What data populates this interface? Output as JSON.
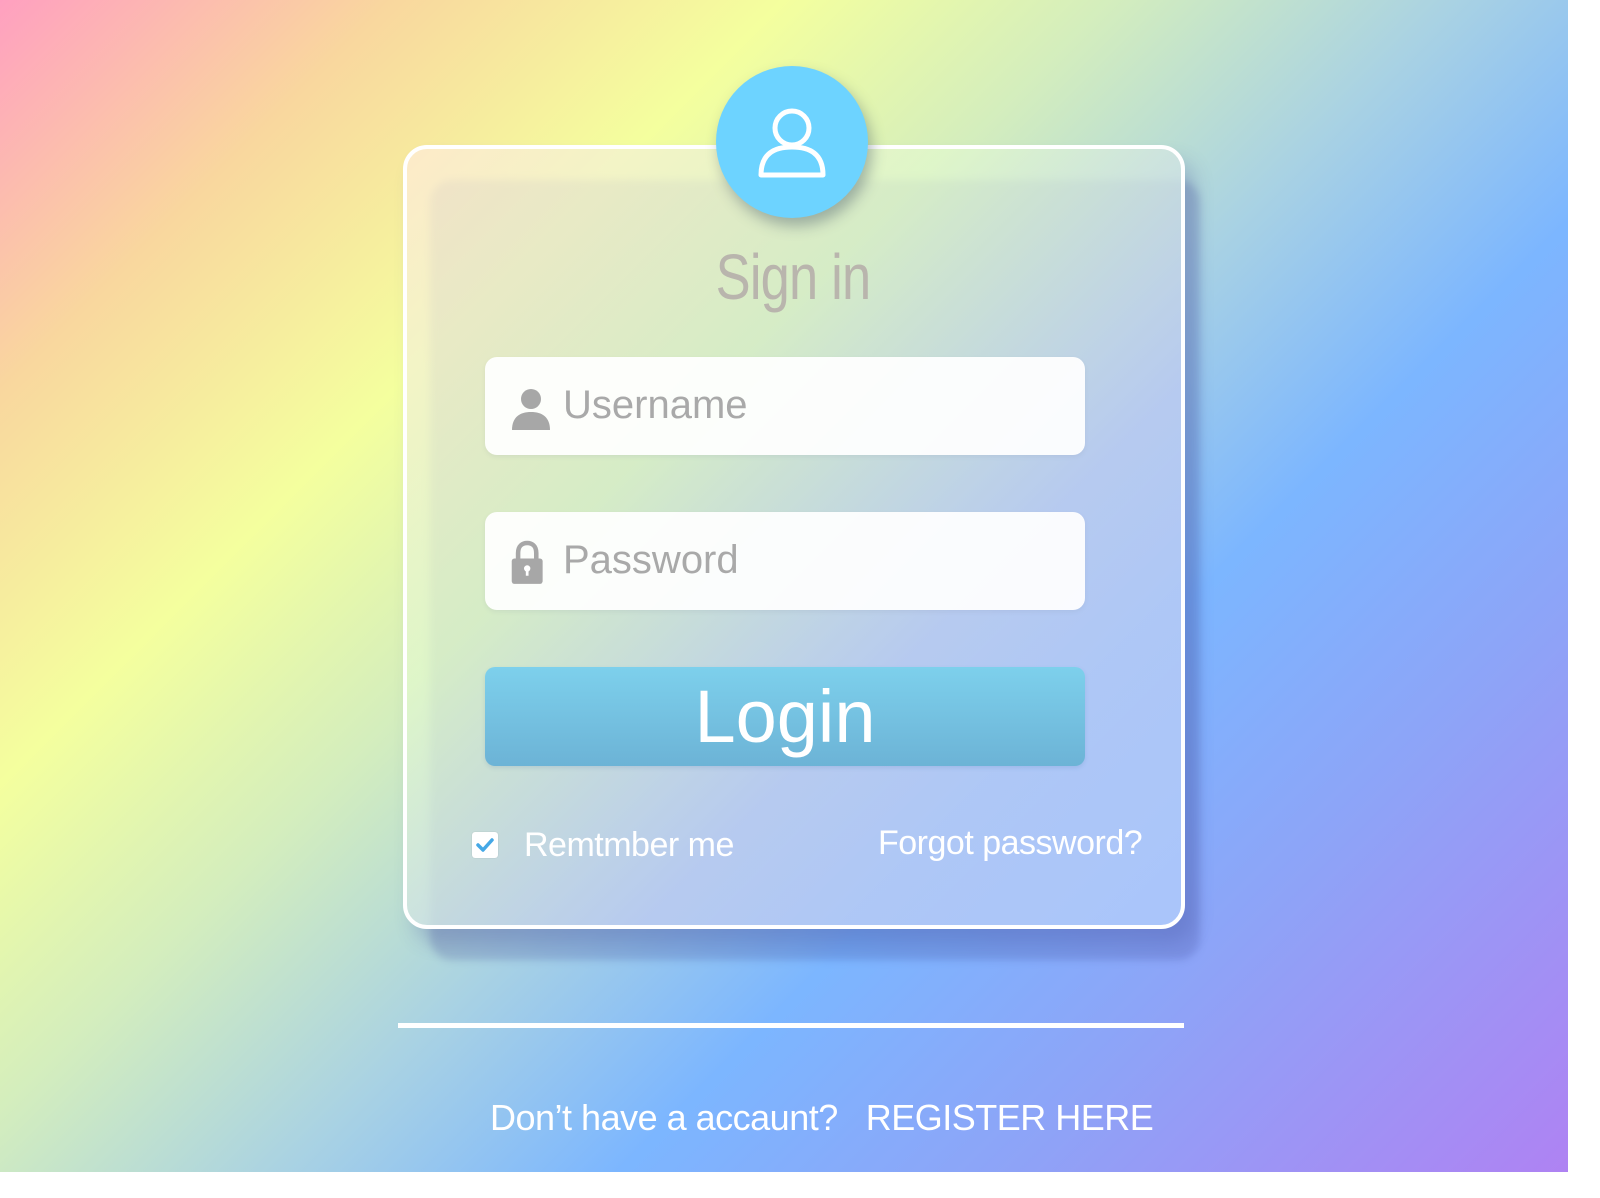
{
  "colors": {
    "avatar": "#6dd3ff",
    "login_button": "#6cb3d6",
    "title": "#b9b5ad",
    "placeholder": "#a9a9a9",
    "checkbox_check": "#45a8e6"
  },
  "header": {
    "title": "Sign in",
    "avatar_icon": "user-outline-icon"
  },
  "form": {
    "username": {
      "placeholder": "Username",
      "value": "",
      "icon": "user-icon"
    },
    "password": {
      "placeholder": "Password",
      "value": "",
      "icon": "lock-icon"
    },
    "login_label": "Login",
    "remember": {
      "label": "Remtmber me",
      "checked": true
    },
    "forgot_label": "Forgot password?"
  },
  "footer": {
    "prompt": "Don’t have a accaunt?",
    "register_label": "REGISTER HERE"
  }
}
